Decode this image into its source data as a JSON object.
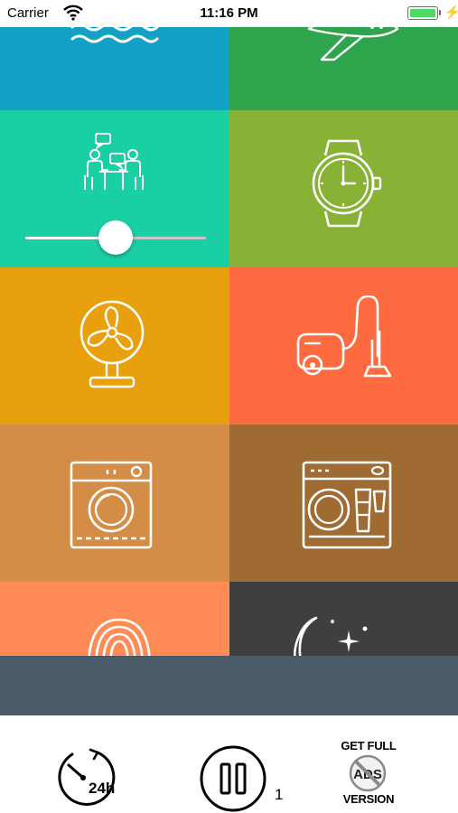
{
  "status_bar": {
    "carrier": "Carrier",
    "time": "11:16 PM",
    "battery_icon": "battery-charging-icon",
    "wifi_icon": "wifi-icon"
  },
  "sound_tiles": [
    {
      "id": "ocean-waves",
      "icon": "waves-icon",
      "color": "#12A0C4"
    },
    {
      "id": "airplane",
      "icon": "airplane-icon",
      "color": "#2EA54C"
    },
    {
      "id": "people-talking",
      "icon": "people-talking-icon",
      "color": "#1BCFA5",
      "active": true,
      "volume": 0.5
    },
    {
      "id": "clock-ticking",
      "icon": "wristwatch-icon",
      "color": "#87B236"
    },
    {
      "id": "fan",
      "icon": "fan-icon",
      "color": "#E8A10D"
    },
    {
      "id": "vacuum-cleaner",
      "icon": "vacuum-cleaner-icon",
      "color": "#FF6B40"
    },
    {
      "id": "washing-machine",
      "icon": "washing-machine-icon",
      "color": "#D48D46"
    },
    {
      "id": "dishwasher",
      "icon": "dishwasher-icon",
      "color": "#A06B33"
    },
    {
      "id": "fingerprint",
      "icon": "fingerprint-icon",
      "color": "#FF8B56"
    },
    {
      "id": "night",
      "icon": "moon-stars-icon",
      "color": "#3F3F3F"
    }
  ],
  "ad_banner": {
    "color": "#4A5A66"
  },
  "bottom_bar": {
    "timer_label": "24h",
    "timer_icon": "timer-icon",
    "pause_icon": "pause-icon",
    "active_count": "1",
    "full_version_top": "GET FULL",
    "full_version_ads": "ADS",
    "full_version_bottom": "VERSION"
  }
}
